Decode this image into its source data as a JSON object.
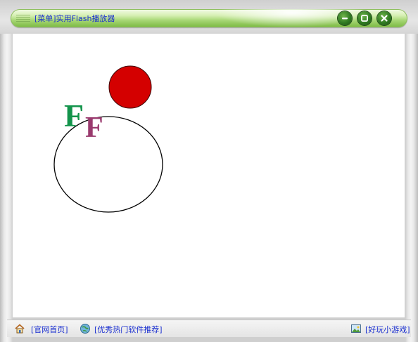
{
  "window": {
    "title": "[菜单]实用Flash播放器",
    "buttons": [
      {
        "name": "minimize-button",
        "icon": "minimize-icon"
      },
      {
        "name": "restore-button",
        "icon": "restore-icon"
      },
      {
        "name": "close-button",
        "icon": "close-icon"
      }
    ]
  },
  "flash_content": {
    "letters": [
      "F",
      "F"
    ],
    "colors": {
      "ball": "#d40000",
      "letter_green": "#13944b",
      "letter_purple": "#9a3a6e",
      "ellipse_stroke": "#000000"
    }
  },
  "statusbar": {
    "home_label": "[官网首页]",
    "recommend_label": "[优秀热门软件推荐]",
    "games_label": "[好玩小游戏]",
    "icons": [
      "home-icon",
      "globe-icon",
      "picture-icon"
    ]
  },
  "colors": {
    "link": "#1a2fd0",
    "titlebar_accent": "#7ab841"
  }
}
